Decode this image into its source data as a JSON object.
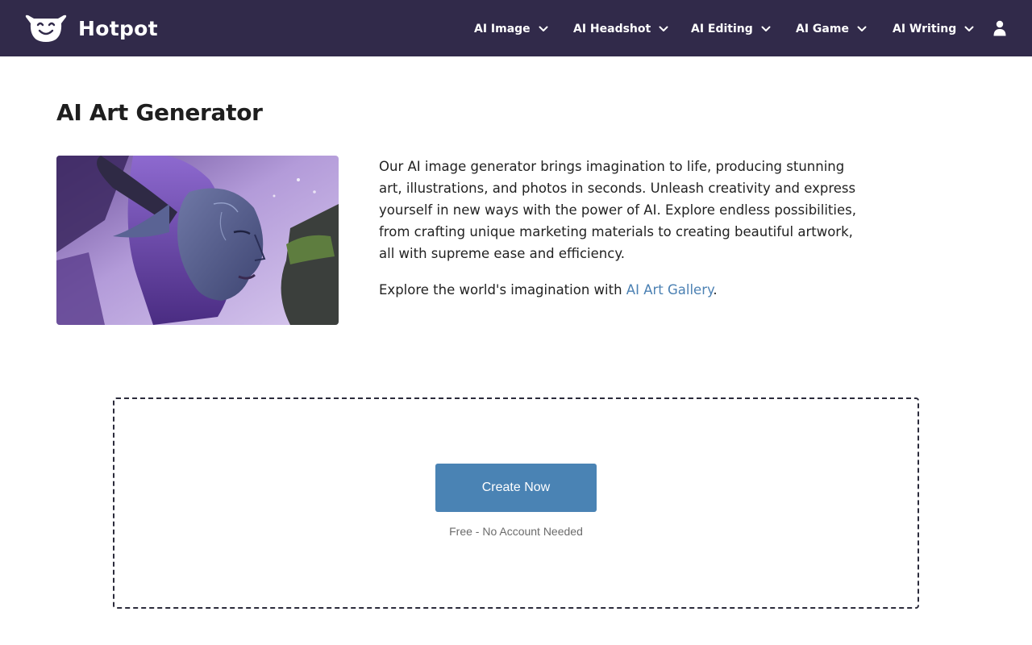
{
  "brand": {
    "name": "Hotpot",
    "logo_icon": "smiling-pot-icon"
  },
  "nav": {
    "items": [
      {
        "label": "AI Image"
      },
      {
        "label": "AI Headshot"
      },
      {
        "label": "AI Editing"
      },
      {
        "label": "AI Game"
      },
      {
        "label": "AI Writing"
      }
    ],
    "account_icon": "user-icon"
  },
  "main": {
    "title": "AI Art Generator",
    "hero_image_alt": "fantasy-elf-woman-illustration",
    "description": "Our AI image generator brings imagination to life, producing stunning art, illustrations, and photos in seconds. Unleash creativity and express yourself in new ways with the power of AI. Explore endless possibilities, from crafting unique marketing materials to creating beautiful artwork, all with supreme ease and efficiency.",
    "gallery_prefix": "Explore the world's imagination with ",
    "gallery_link": "AI Art Gallery",
    "gallery_suffix": "."
  },
  "cta": {
    "button_label": "Create Now",
    "note": "Free - No Account Needed"
  },
  "colors": {
    "header_bg": "#312a4a",
    "accent": "#4a83b4",
    "link": "#4c81b3"
  }
}
